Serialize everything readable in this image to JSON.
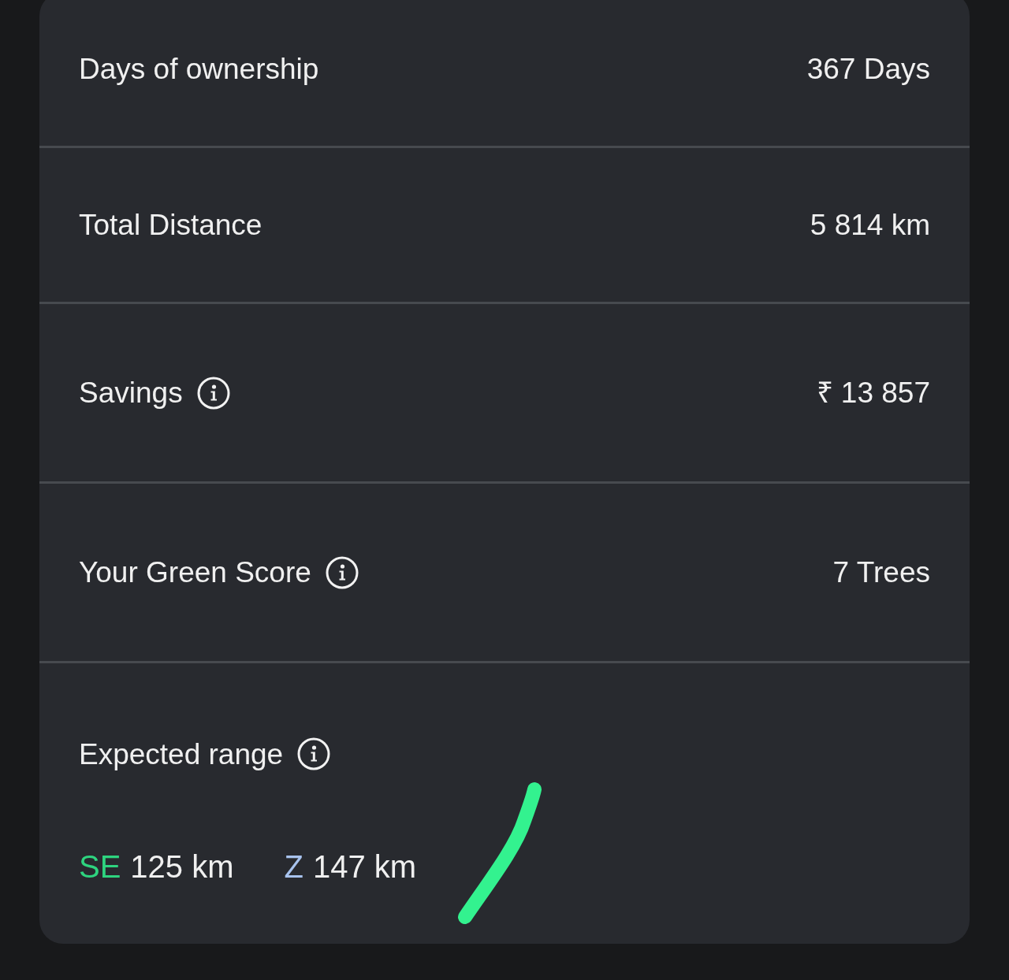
{
  "stats": [
    {
      "label": "Days of ownership",
      "info": false,
      "value": "367 Days"
    },
    {
      "label": "Total Distance",
      "info": false,
      "value": "5 814 km"
    },
    {
      "label": "Savings",
      "info": true,
      "value": "₹ 13 857"
    },
    {
      "label": "Your Green Score",
      "info": true,
      "value": "7 Trees"
    }
  ],
  "expected_range": {
    "label": "Expected range",
    "info": true,
    "items": [
      {
        "code": "SE",
        "color": "#2ed47f",
        "value": "125 km"
      },
      {
        "code": "Z",
        "color": "#a8c3ee",
        "value": "147 km"
      }
    ]
  },
  "pen_mark": {
    "kind": "stroke"
  }
}
